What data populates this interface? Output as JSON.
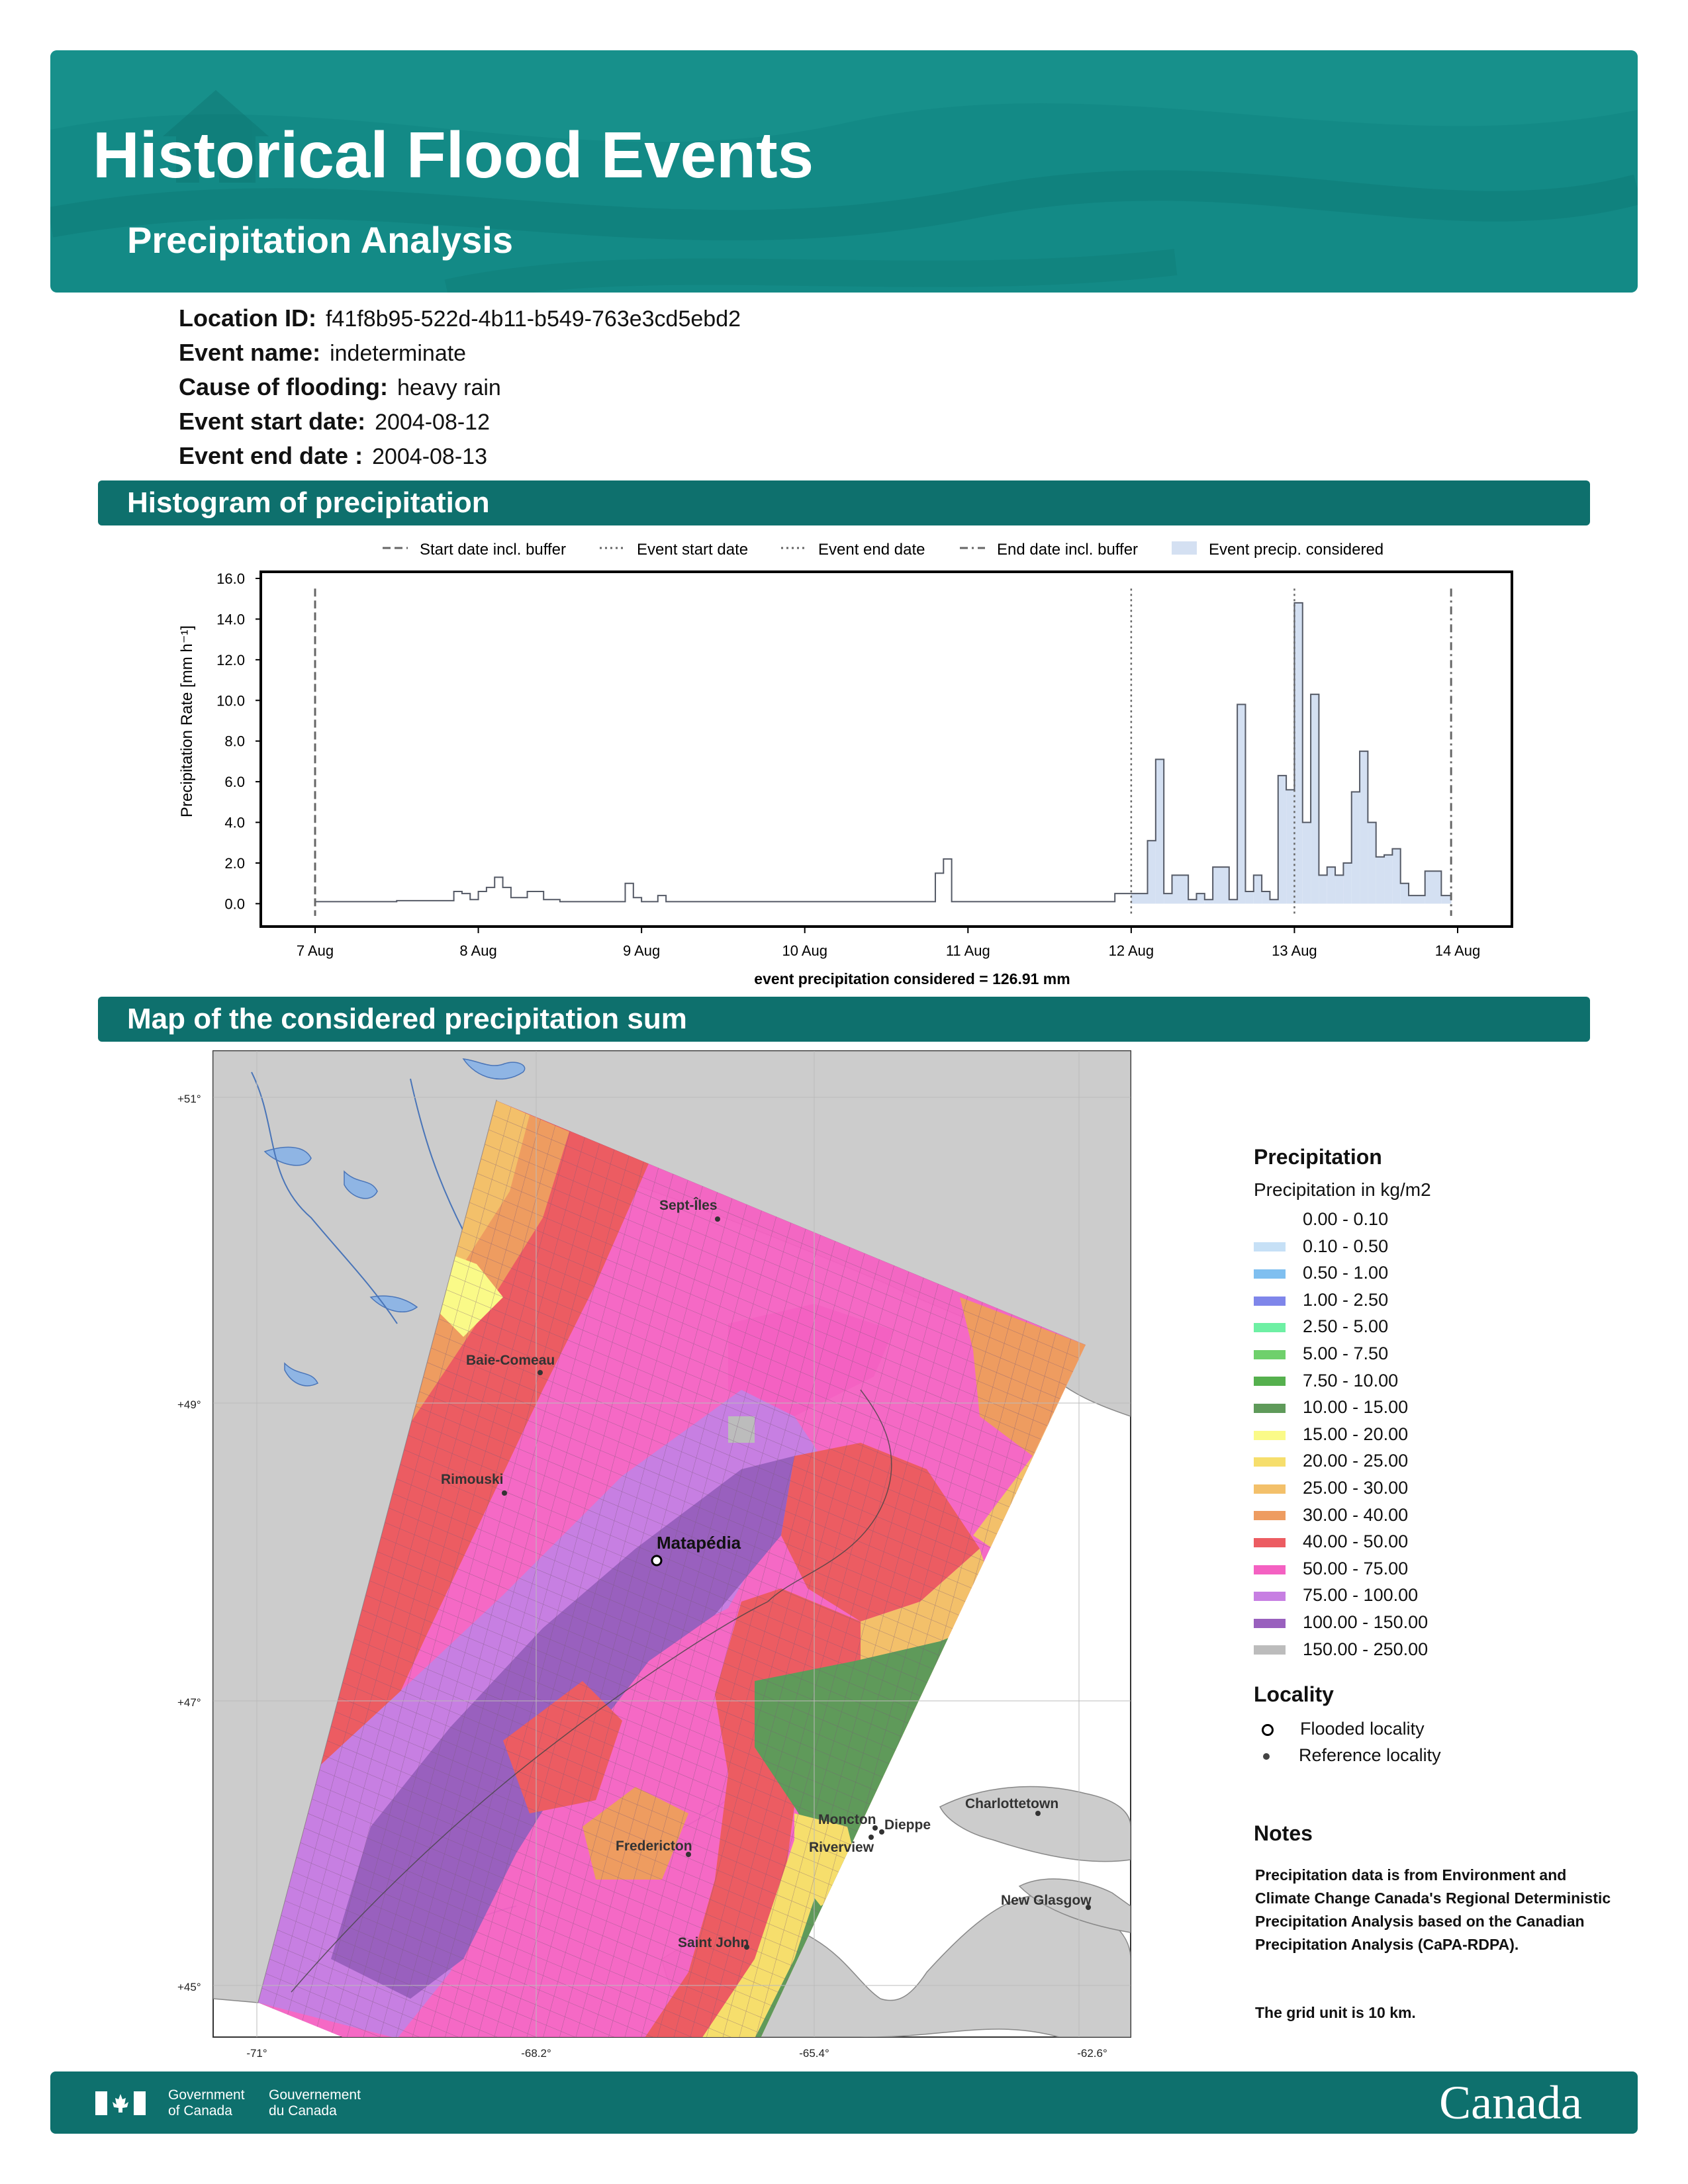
{
  "header": {
    "title": "Historical Flood Events",
    "subtitle": "Precipitation Analysis",
    "bg_color": "#138a86"
  },
  "info": [
    {
      "label": "Location ID:",
      "value": "f41f8b95-522d-4b11-b549-763e3cd5ebd2"
    },
    {
      "label": "Event name:",
      "value": "indeterminate"
    },
    {
      "label": "Cause of flooding:",
      "value": "heavy rain"
    },
    {
      "label": "Event start date:",
      "value": "2004-08-12"
    },
    {
      "label": "Event end date :",
      "value": "2004-08-13"
    }
  ],
  "sections": {
    "histogram": "Histogram of precipitation",
    "map": "Map of the considered precipitation sum"
  },
  "chart_data": {
    "type": "bar",
    "legend": [
      "Start date incl. buffer",
      "Event start date",
      "Event end date",
      "End date incl. buffer",
      "Event precip. considered"
    ],
    "ylabel": "Precipitation Rate [mm h⁻¹]",
    "xlabel": "event precipitation considered = 126.91 mm",
    "ylim": [
      -0.8,
      16.0
    ],
    "yticks": [
      "0.0",
      "2.0",
      "4.0",
      "6.0",
      "8.0",
      "10.0",
      "12.0",
      "14.0",
      "16.0"
    ],
    "xticks": [
      "7 Aug",
      "8 Aug",
      "9 Aug",
      "10 Aug",
      "11 Aug",
      "12 Aug",
      "13 Aug",
      "14 Aug"
    ],
    "x_unit": "days since 7 Aug 00:00",
    "start_buffer": 0.0,
    "event_start": 5.0,
    "event_end": 6.0,
    "end_buffer": 6.96,
    "considered_range": [
      5.0,
      6.96
    ],
    "fill_color": "#d4e0f2",
    "line_color": "#555a66",
    "x": [
      0.0,
      0.25,
      0.5,
      0.75,
      0.85,
      0.9,
      0.95,
      1.0,
      1.05,
      1.1,
      1.15,
      1.2,
      1.25,
      1.3,
      1.35,
      1.4,
      1.5,
      1.6,
      1.7,
      1.9,
      1.95,
      2.0,
      2.1,
      2.15,
      2.5,
      2.6,
      3.2,
      3.4,
      3.7,
      3.8,
      3.85,
      3.9,
      3.95,
      4.2,
      4.4,
      4.7,
      4.9,
      4.95,
      5.0,
      5.1,
      5.15,
      5.2,
      5.25,
      5.35,
      5.4,
      5.45,
      5.5,
      5.6,
      5.65,
      5.7,
      5.75,
      5.8,
      5.85,
      5.9,
      5.95,
      6.0,
      6.05,
      6.1,
      6.15,
      6.2,
      6.25,
      6.3,
      6.35,
      6.4,
      6.45,
      6.5,
      6.55,
      6.6,
      6.65,
      6.7,
      6.8,
      6.9,
      6.96
    ],
    "values": [
      0.1,
      0.1,
      0.15,
      0.15,
      0.6,
      0.5,
      0.2,
      0.6,
      0.8,
      1.3,
      0.8,
      0.3,
      0.3,
      0.6,
      0.6,
      0.2,
      0.1,
      0.1,
      0.1,
      1.0,
      0.3,
      0.1,
      0.4,
      0.1,
      0.1,
      0.1,
      0.1,
      0.1,
      0.1,
      1.5,
      2.2,
      0.1,
      0.1,
      0.1,
      0.1,
      0.1,
      0.5,
      0.5,
      0.5,
      3.1,
      7.1,
      0.5,
      1.4,
      0.2,
      0.5,
      0.2,
      1.8,
      0.2,
      9.8,
      0.6,
      1.4,
      0.6,
      0.2,
      6.3,
      5.6,
      14.8,
      4.0,
      10.3,
      1.4,
      1.8,
      1.4,
      2.0,
      5.5,
      7.5,
      4.0,
      2.3,
      2.4,
      2.7,
      1.0,
      0.4,
      1.6,
      0.4,
      0.2
    ]
  },
  "map": {
    "lat_labels": [
      "+51°",
      "+49°",
      "+47°",
      "+45°"
    ],
    "lon_labels": [
      "-71°",
      "-68.2°",
      "-65.4°",
      "-62.6°"
    ],
    "flooded_locality": "Matapédia",
    "reference_localities": [
      "Sept-Îles",
      "Baie-Comeau",
      "Rimouski",
      "Fredericton",
      "Saint John",
      "Moncton",
      "Dieppe",
      "Riverview",
      "Charlottetown",
      "New Glasgow"
    ]
  },
  "legend": {
    "title": "Precipitation",
    "subtitle": "Precipitation in kg/m2",
    "items": [
      {
        "label": "0.00 - 0.10",
        "color": "#ffffff"
      },
      {
        "label": "0.10 - 0.50",
        "color": "#c6e0f6"
      },
      {
        "label": "0.50 - 1.00",
        "color": "#7fbff0"
      },
      {
        "label": "1.00 - 2.50",
        "color": "#7f86ea"
      },
      {
        "label": "2.50 - 5.00",
        "color": "#6ef0a4"
      },
      {
        "label": "5.00 - 7.50",
        "color": "#6fd06c"
      },
      {
        "label": "7.50 - 10.00",
        "color": "#55b04e"
      },
      {
        "label": "10.00 - 15.00",
        "color": "#5f9a5a"
      },
      {
        "label": "15.00 - 20.00",
        "color": "#fafa88"
      },
      {
        "label": "20.00 - 25.00",
        "color": "#f6de6c"
      },
      {
        "label": "25.00 - 30.00",
        "color": "#f3c06a"
      },
      {
        "label": "30.00 - 40.00",
        "color": "#ee9c60"
      },
      {
        "label": "40.00 - 50.00",
        "color": "#ec5c62"
      },
      {
        "label": "50.00 - 75.00",
        "color": "#f461c2"
      },
      {
        "label": "75.00 - 100.00",
        "color": "#c77fe2"
      },
      {
        "label": "100.00 - 150.00",
        "color": "#9960be"
      },
      {
        "label": "150.00 - 250.00",
        "color": "#bcbcbc"
      }
    ],
    "locality_title": "Locality",
    "locality_items": [
      "Flooded locality",
      "Reference locality"
    ]
  },
  "notes": {
    "title": "Notes",
    "text1": "Precipitation data is from Environment and Climate Change Canada's Regional Deterministic Precipitation Analysis based on the Canadian Precipitation Analysis (CaPA-RDPA).",
    "text2": "The grid unit is 10 km."
  },
  "footer": {
    "gov_en_1": "Government",
    "gov_en_2": "of Canada",
    "gov_fr_1": "Gouvernement",
    "gov_fr_2": "du Canada",
    "wordmark": "Canada"
  }
}
